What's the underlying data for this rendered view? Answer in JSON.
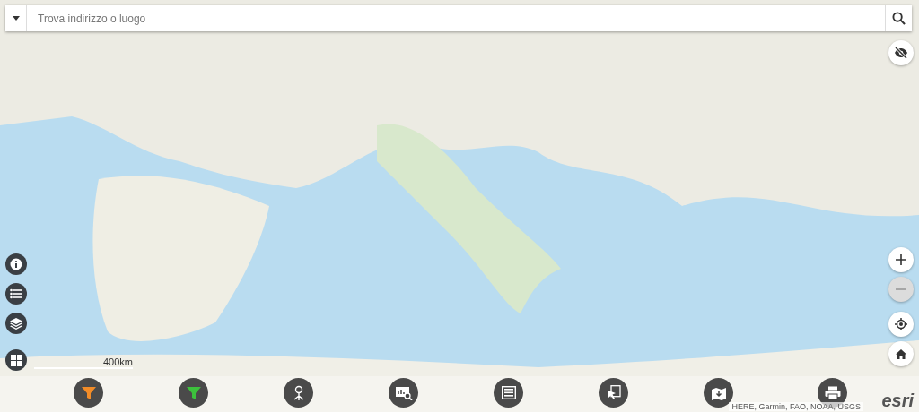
{
  "search": {
    "placeholder": "Trova indirizzo o luogo"
  },
  "left_tools": [
    {
      "kind": "info"
    },
    {
      "kind": "list"
    },
    {
      "kind": "layers"
    },
    {
      "kind": "grid"
    }
  ],
  "right_tools": [
    {
      "kind": "zoom-in",
      "disabled": false
    },
    {
      "kind": "zoom-out",
      "disabled": true
    },
    {
      "kind": "locate",
      "disabled": false
    },
    {
      "kind": "home",
      "disabled": false
    }
  ],
  "scale_bar": {
    "label": "400km"
  },
  "toolbar": [
    {
      "kind": "filter",
      "color": "#f28c28"
    },
    {
      "kind": "filter",
      "color": "#3cc13c"
    },
    {
      "kind": "network"
    },
    {
      "kind": "chart-search"
    },
    {
      "kind": "table"
    },
    {
      "kind": "select"
    },
    {
      "kind": "export"
    },
    {
      "kind": "print"
    }
  ],
  "attribution": "HERE, Garmin, FAO, NOAA, USGS",
  "logo": {
    "text": "esri"
  }
}
